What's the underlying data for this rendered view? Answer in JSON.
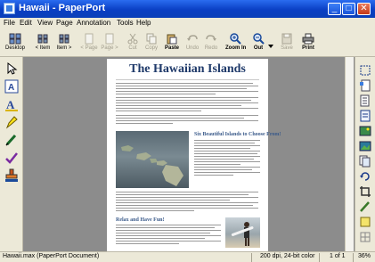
{
  "window": {
    "title": "Hawaii - PaperPort"
  },
  "menu": [
    "File",
    "Edit",
    "View",
    "Page",
    "Annotation",
    "Tools",
    "Help"
  ],
  "toolbar": {
    "desktop": "Desktop",
    "item_prev": "< Item",
    "item_next": "Item >",
    "page_prev": "< Page",
    "page_next": "Page >",
    "cut": "Cut",
    "copy": "Copy",
    "paste": "Paste",
    "undo": "Undo",
    "redo": "Redo",
    "zoom_in": "Zoom In",
    "zoom_out": "Out",
    "save": "Save",
    "print": "Print"
  },
  "document": {
    "title": "The Hawaiian Islands",
    "subheading_1": "Six Beautiful Islands to Choose From!",
    "subheading_2": "Relax and Have Fun!"
  },
  "status": {
    "document": "Hawaii.max (PaperPort Document)",
    "resolution": "200 dpi, 24-bit color",
    "page": "1 of 1",
    "zoom": "36%"
  },
  "colors": {
    "titlebar": "#0a3fc4",
    "chrome": "#ece9d8",
    "workspace": "#8c8c8c",
    "doc_title": "#1f3a6a"
  }
}
